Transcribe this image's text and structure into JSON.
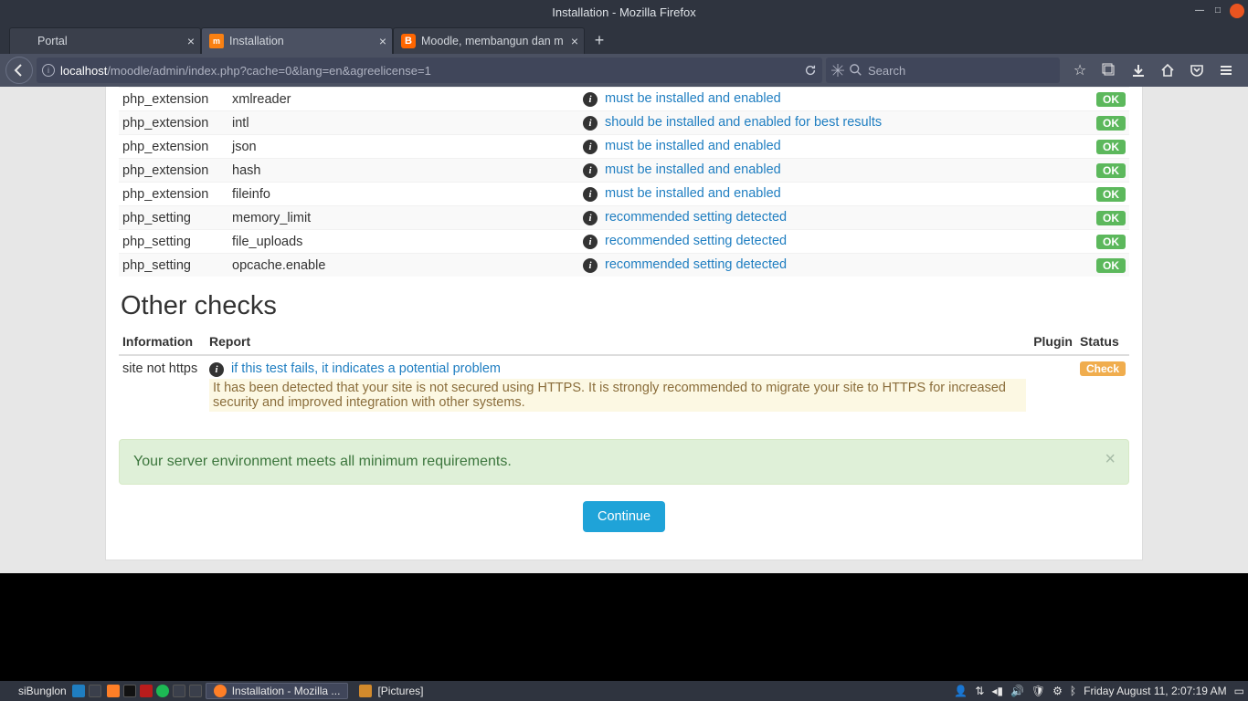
{
  "window_title": "Installation - Mozilla Firefox",
  "tabs": [
    {
      "label": "Portal"
    },
    {
      "label": "Installation"
    },
    {
      "label": "Moodle, membangun dan m"
    }
  ],
  "url": {
    "host": "localhost",
    "path": "/moodle/admin/index.php?cache=0&lang=en&agreelicense=1"
  },
  "search_placeholder": "Search",
  "checks": [
    {
      "type": "php_extension",
      "name": "xmlreader",
      "report": "must be installed and enabled",
      "status": "OK",
      "alt": false
    },
    {
      "type": "php_extension",
      "name": "intl",
      "report": "should be installed and enabled for best results",
      "status": "OK",
      "alt": true
    },
    {
      "type": "php_extension",
      "name": "json",
      "report": "must be installed and enabled",
      "status": "OK",
      "alt": false
    },
    {
      "type": "php_extension",
      "name": "hash",
      "report": "must be installed and enabled",
      "status": "OK",
      "alt": true
    },
    {
      "type": "php_extension",
      "name": "fileinfo",
      "report": "must be installed and enabled",
      "status": "OK",
      "alt": false
    },
    {
      "type": "php_setting",
      "name": "memory_limit",
      "report": "recommended setting detected",
      "status": "OK",
      "alt": true
    },
    {
      "type": "php_setting",
      "name": "file_uploads",
      "report": "recommended setting detected",
      "status": "OK",
      "alt": false
    },
    {
      "type": "php_setting",
      "name": "opcache.enable",
      "report": "recommended setting detected",
      "status": "OK",
      "alt": true
    }
  ],
  "other_heading": "Other checks",
  "other_headers": {
    "information": "Information",
    "report": "Report",
    "plugin": "Plugin",
    "status": "Status"
  },
  "other_row": {
    "information": "site not https",
    "report_link": "if this test fails, it indicates a potential problem",
    "report_warning": "It has been detected that your site is not secured using HTTPS. It is strongly recommended to migrate your site to HTTPS for increased security and improved integration with other systems.",
    "status": "Check"
  },
  "alert_success": "Your server environment meets all minimum requirements.",
  "continue_label": "Continue",
  "taskbar": {
    "hostname": "siBunglon",
    "app1": "Installation - Mozilla ...",
    "app2": "[Pictures]",
    "datetime": "Friday August 11,  2:07:19 AM"
  }
}
